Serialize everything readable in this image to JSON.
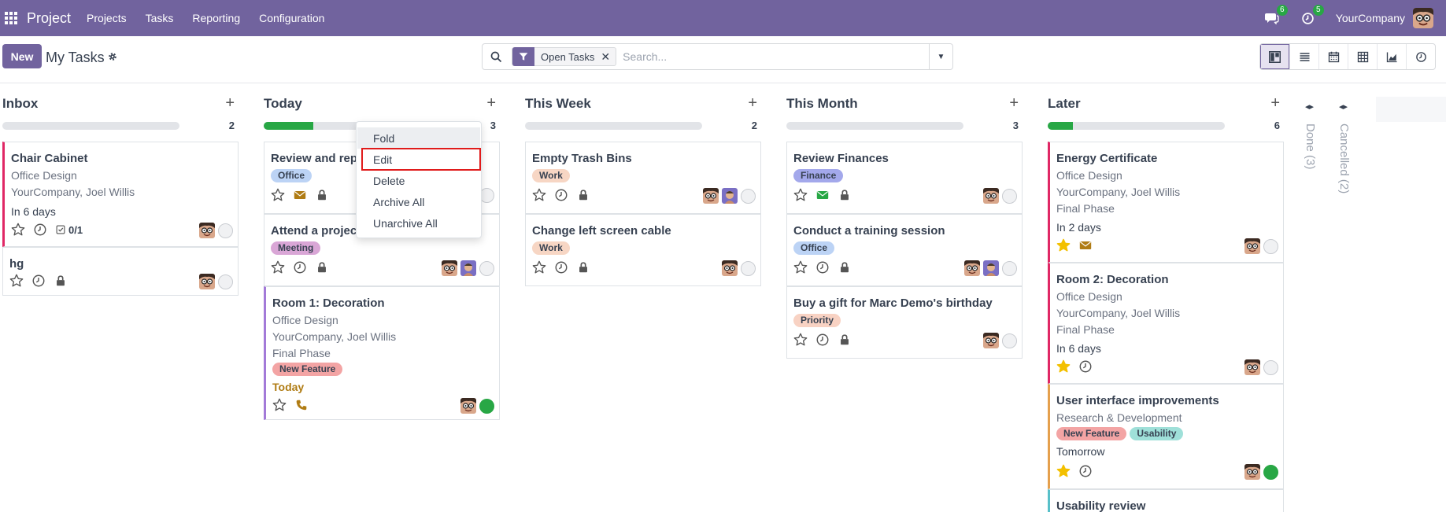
{
  "navbar": {
    "app_name": "Project",
    "menu": [
      "Projects",
      "Tasks",
      "Reporting",
      "Configuration"
    ],
    "messages_count": "6",
    "activities_count": "5",
    "company": "YourCompany"
  },
  "control_panel": {
    "new_label": "New",
    "title": "My Tasks",
    "facet_label": "Open Tasks",
    "search_placeholder": "Search..."
  },
  "views": [
    "kanban",
    "list",
    "calendar",
    "pivot",
    "graph",
    "activity"
  ],
  "dropdown": {
    "items": [
      "Fold",
      "Edit",
      "Delete",
      "Archive All",
      "Unarchive All"
    ]
  },
  "columns": [
    {
      "title": "Inbox",
      "count": "2",
      "progress_pct": 0,
      "cards": [
        {
          "title": "Chair Cabinet",
          "lines": [
            "Office Design",
            "YourCompany, Joel Willis"
          ],
          "deadline": "In 6 days",
          "subtasks": "0/1"
        },
        {
          "title": "hg"
        }
      ]
    },
    {
      "title": "Today",
      "count": "3",
      "progress_pct": 28,
      "cards": [
        {
          "title": "Review and rep",
          "tags": [
            "Office"
          ]
        },
        {
          "title": "Attend a projec",
          "tags": [
            "Meeting"
          ]
        },
        {
          "title": "Room 1: Decoration",
          "lines": [
            "Office Design",
            "YourCompany, Joel Willis",
            "Final Phase"
          ],
          "tags": [
            "New Feature"
          ],
          "deadline": "Today"
        }
      ]
    },
    {
      "title": "This Week",
      "count": "2",
      "progress_pct": 0,
      "cards": [
        {
          "title": "Empty Trash Bins",
          "tags": [
            "Work"
          ]
        },
        {
          "title": "Change left screen cable",
          "tags": [
            "Work"
          ]
        }
      ]
    },
    {
      "title": "This Month",
      "count": "3",
      "progress_pct": 0,
      "cards": [
        {
          "title": "Review Finances",
          "tags": [
            "Finance"
          ]
        },
        {
          "title": "Conduct a training session",
          "tags": [
            "Office"
          ]
        },
        {
          "title": "Buy a gift for Marc Demo's birthday",
          "tags": [
            "Priority"
          ]
        }
      ]
    },
    {
      "title": "Later",
      "count": "6",
      "progress_pct": 14,
      "cards": [
        {
          "title": "Energy Certificate",
          "lines": [
            "Office Design",
            "YourCompany, Joel Willis",
            "Final Phase"
          ],
          "deadline": "In 2 days"
        },
        {
          "title": "Room 2: Decoration",
          "lines": [
            "Office Design",
            "YourCompany, Joel Willis",
            "Final Phase"
          ],
          "deadline": "In 6 days"
        },
        {
          "title": "User interface improvements",
          "lines": [
            "Research & Development"
          ],
          "tags": [
            "New Feature",
            "Usability"
          ],
          "deadline": "Tomorrow"
        },
        {
          "title": "Usability review"
        }
      ]
    }
  ],
  "folded_columns": [
    "Done (3)",
    "Cancelled (2)"
  ],
  "colors": {
    "primary": "#71639e",
    "success": "#28a745",
    "highlight": "#e01b1b"
  }
}
